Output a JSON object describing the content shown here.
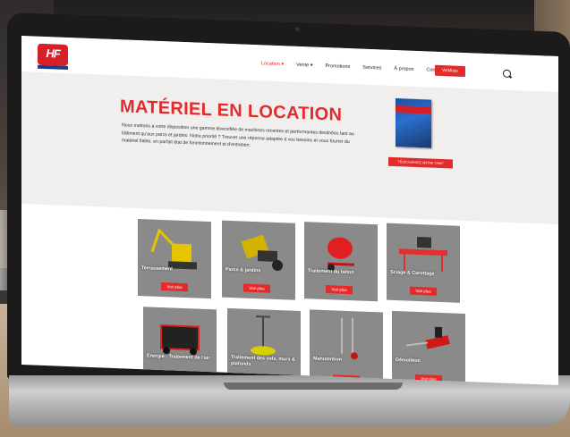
{
  "nav": {
    "logo_text": "HF",
    "menu": [
      "Location ▾",
      "Vente ▾",
      "Promotions",
      "Services",
      "À propos",
      "Contact"
    ],
    "cta_label": "Wrklists"
  },
  "hero": {
    "title": "MATÉRIEL EN LOCATION",
    "text": "Nous mettons à votre disposition une gamme diversifiée de machines récentes et performantes destinées tant au bâtiment qu’aux parcs et jardins. Notre priorité ? Trouver une réponse adaptée à vos besoins et vous fournir du matériel fiable, en parfait état de fonctionnement et d’entretien.",
    "catalog_title": "CATALOGUE LOCATION",
    "catalog_button": "TÉLÉCHARGEZ NOTRE TARIF"
  },
  "cards": [
    {
      "label": "Terrassement",
      "cta": "Voir plus"
    },
    {
      "label": "Parcs & jardins",
      "cta": "Voir plus"
    },
    {
      "label": "Traitement du béton",
      "cta": "Voir plus"
    },
    {
      "label": "Sciage & Carottage",
      "cta": "Voir plus"
    },
    {
      "label": "Énergie - Traitement de l'air",
      "cta": "Voir plus"
    },
    {
      "label": "Traitement des sols, murs & plafonds",
      "cta": "Voir plus"
    },
    {
      "label": "Manutention",
      "cta": "Voir plus"
    },
    {
      "label": "Démolition",
      "cta": "Voir plus"
    }
  ],
  "colors": {
    "brand_red": "#e32b2b",
    "card_gray": "#8a8a8a",
    "brand_blue": "#1b3a8a"
  }
}
